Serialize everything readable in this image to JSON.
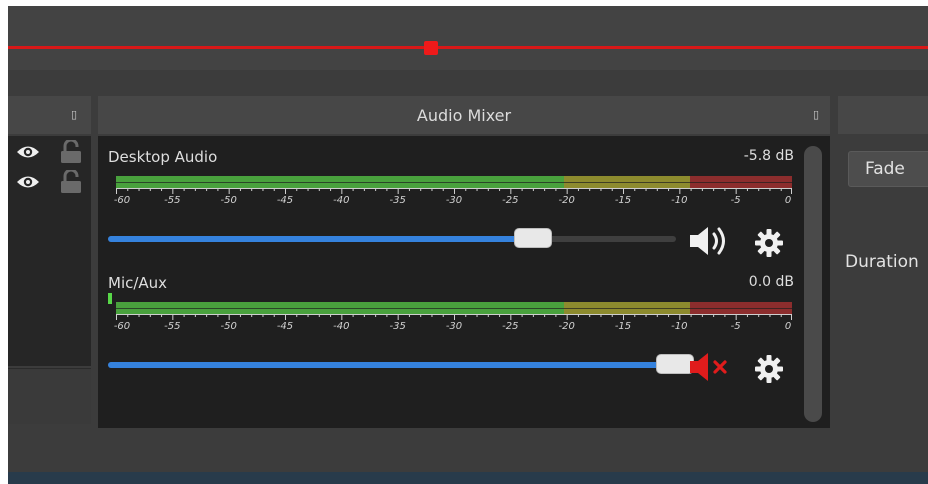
{
  "timeline": {
    "position_fraction": 0.46
  },
  "sources": {
    "float_icon": "float-icon",
    "rows": [
      {
        "visible_icon": "eye-icon",
        "lock_icon": "unlocked-padlock-icon"
      },
      {
        "visible_icon": "eye-icon",
        "lock_icon": "unlocked-padlock-icon"
      }
    ]
  },
  "mixer": {
    "title": "Audio Mixer",
    "float_icon": "float-icon",
    "tick_labels": [
      "-60",
      "-55",
      "-50",
      "-45",
      "-40",
      "-35",
      "-30",
      "-25",
      "-20",
      "-15",
      "-10",
      "-5",
      "0"
    ],
    "colors": {
      "meter_green": "#49a13d",
      "meter_yellow": "#8d8b2e",
      "meter_red": "#8c2d2d",
      "slider_blue": "#3582dd",
      "muted_red": "#e01c1c"
    },
    "channels": [
      {
        "name": "Desktop Audio",
        "db": "-5.8 dB",
        "volume_fraction": 0.74,
        "muted": false,
        "speaker_icon": "speaker-volume-icon",
        "settings_icon": "gear-icon"
      },
      {
        "name": "Mic/Aux",
        "db": "0.0 dB",
        "volume_fraction": 1.0,
        "muted": true,
        "speaker_icon": "speaker-muted-icon",
        "settings_icon": "gear-icon"
      }
    ]
  },
  "transitions": {
    "fade_label": "Fade",
    "duration_label": "Duration"
  }
}
